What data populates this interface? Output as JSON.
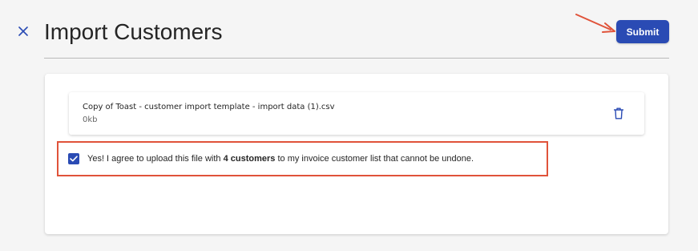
{
  "header": {
    "title": "Import Customers",
    "submit_label": "Submit",
    "close_icon": "close-icon"
  },
  "file": {
    "name": "Copy of Toast - customer import template - import data (1).csv",
    "size": "0kb",
    "delete_icon": "trash-icon"
  },
  "agreement": {
    "checked": true,
    "text_before": "Yes! I agree to upload this file with ",
    "text_bold": "4 customers",
    "text_after": " to my invoice customer list that cannot be undone."
  },
  "colors": {
    "accent": "#2a4bb4",
    "annotation": "#e0533a",
    "background": "#f5f5f5"
  }
}
